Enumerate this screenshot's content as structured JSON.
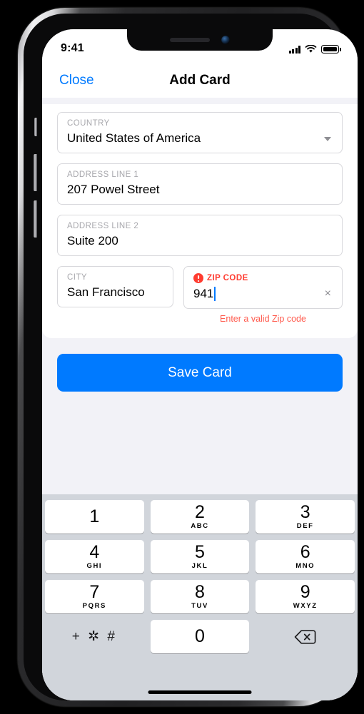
{
  "status_bar": {
    "time": "9:41",
    "signal_icon": "cellular-signal-icon",
    "wifi_icon": "wifi-icon",
    "battery_icon": "battery-full-icon"
  },
  "nav_bar": {
    "close_label": "Close",
    "title": "Add Card"
  },
  "form": {
    "country": {
      "label": "COUNTRY",
      "value": "United States of America",
      "chevron_icon": "chevron-down-icon"
    },
    "address_line_1": {
      "label": "ADDRESS LINE 1",
      "value": "207 Powel Street"
    },
    "address_line_2": {
      "label": "ADDRESS LINE 2",
      "value": "Suite 200"
    },
    "city": {
      "label": "CITY",
      "value": "San Francisco"
    },
    "zip_code": {
      "label": "ZIP CODE",
      "value": "941",
      "error_icon": "error-exclamation-circle-icon",
      "error_text": "Enter a valid Zip code",
      "clear_icon": "×",
      "has_focus": true
    }
  },
  "actions": {
    "save_label": "Save Card"
  },
  "keypad": {
    "keys": [
      {
        "digit": "1",
        "letters": ""
      },
      {
        "digit": "2",
        "letters": "ABC"
      },
      {
        "digit": "3",
        "letters": "DEF"
      },
      {
        "digit": "4",
        "letters": "GHI"
      },
      {
        "digit": "5",
        "letters": "JKL"
      },
      {
        "digit": "6",
        "letters": "MNO"
      },
      {
        "digit": "7",
        "letters": "PQRS"
      },
      {
        "digit": "8",
        "letters": "TUV"
      },
      {
        "digit": "9",
        "letters": "WXYZ"
      },
      {
        "digit": "0",
        "letters": ""
      }
    ],
    "symbols_label": "+ ✲ #",
    "delete_icon": "delete-backspace-icon"
  },
  "colors": {
    "accent_blue": "#007aff",
    "error_red": "#ff3b30",
    "error_text_red": "#ff5a4d",
    "page_background": "#f2f2f7",
    "keypad_background": "#d1d5db",
    "label_gray": "#a8a8ad"
  }
}
